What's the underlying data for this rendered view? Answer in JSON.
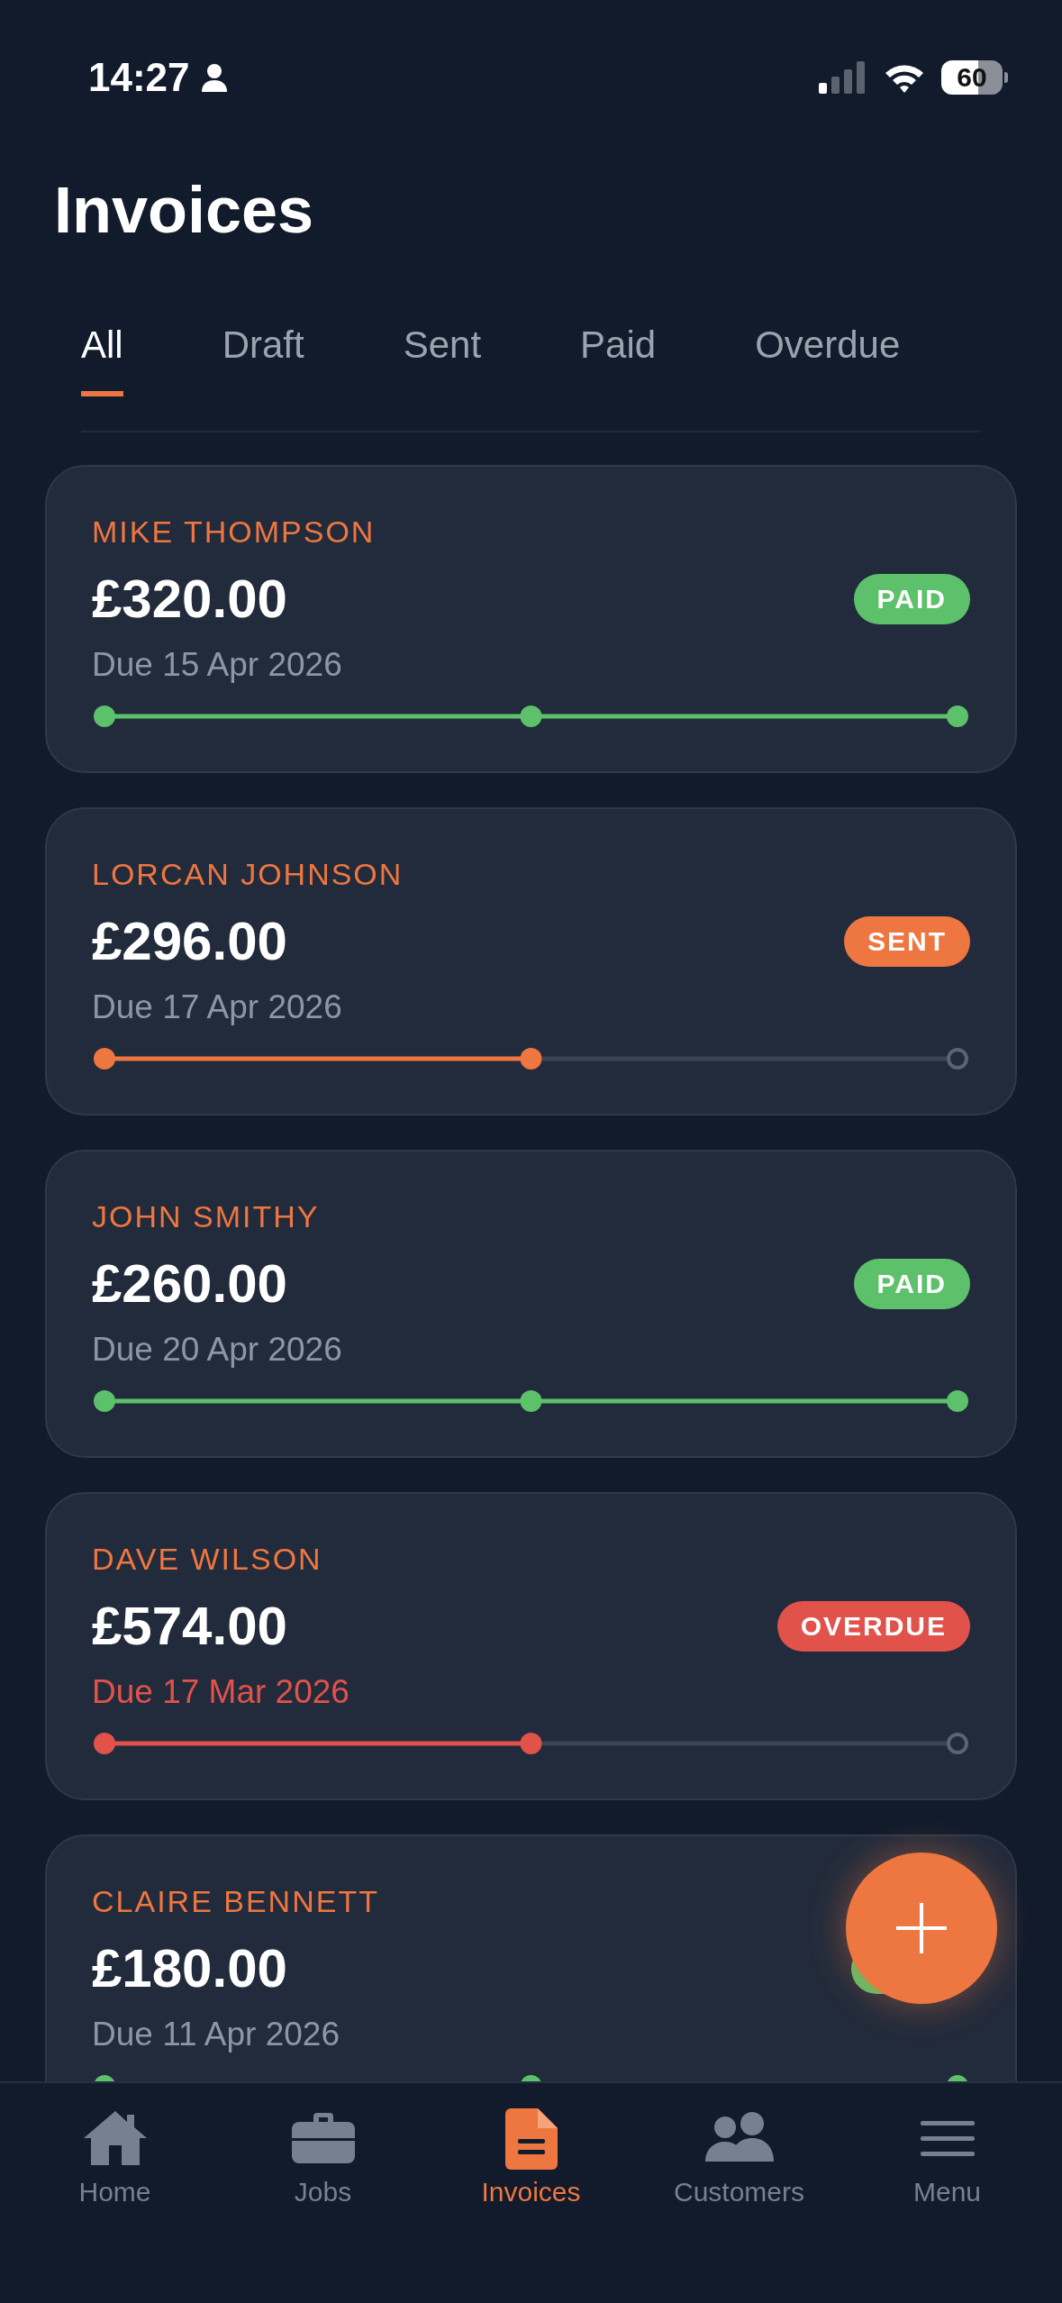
{
  "status_bar": {
    "time": "14:27",
    "battery": "60"
  },
  "title": "Invoices",
  "tabs": [
    {
      "label": "All",
      "selected": true
    },
    {
      "label": "Draft",
      "selected": false
    },
    {
      "label": "Sent",
      "selected": false
    },
    {
      "label": "Paid",
      "selected": false
    },
    {
      "label": "Overdue",
      "selected": false
    }
  ],
  "invoices": [
    {
      "customer": "MIKE THOMPSON",
      "amount": "£320.00",
      "due": "Due 15 Apr 2026",
      "kind": "paid",
      "badge": "PAID"
    },
    {
      "customer": "LORCAN JOHNSON",
      "amount": "£296.00",
      "due": "Due 17 Apr 2026",
      "kind": "sent",
      "badge": "SENT"
    },
    {
      "customer": "JOHN SMITHY",
      "amount": "£260.00",
      "due": "Due 20 Apr 2026",
      "kind": "paid",
      "badge": "PAID"
    },
    {
      "customer": "DAVE WILSON",
      "amount": "£574.00",
      "due": "Due 17 Mar 2026",
      "kind": "overdue",
      "badge": "OVERDUE"
    },
    {
      "customer": "CLAIRE BENNETT",
      "amount": "£180.00",
      "due": "Due 11 Apr 2026",
      "kind": "paid"
    }
  ],
  "nav": [
    {
      "label": "Home",
      "selected": false
    },
    {
      "label": "Jobs",
      "selected": false
    },
    {
      "label": "Invoices",
      "selected": true
    },
    {
      "label": "Customers",
      "selected": false
    },
    {
      "label": "Menu",
      "selected": false
    }
  ]
}
